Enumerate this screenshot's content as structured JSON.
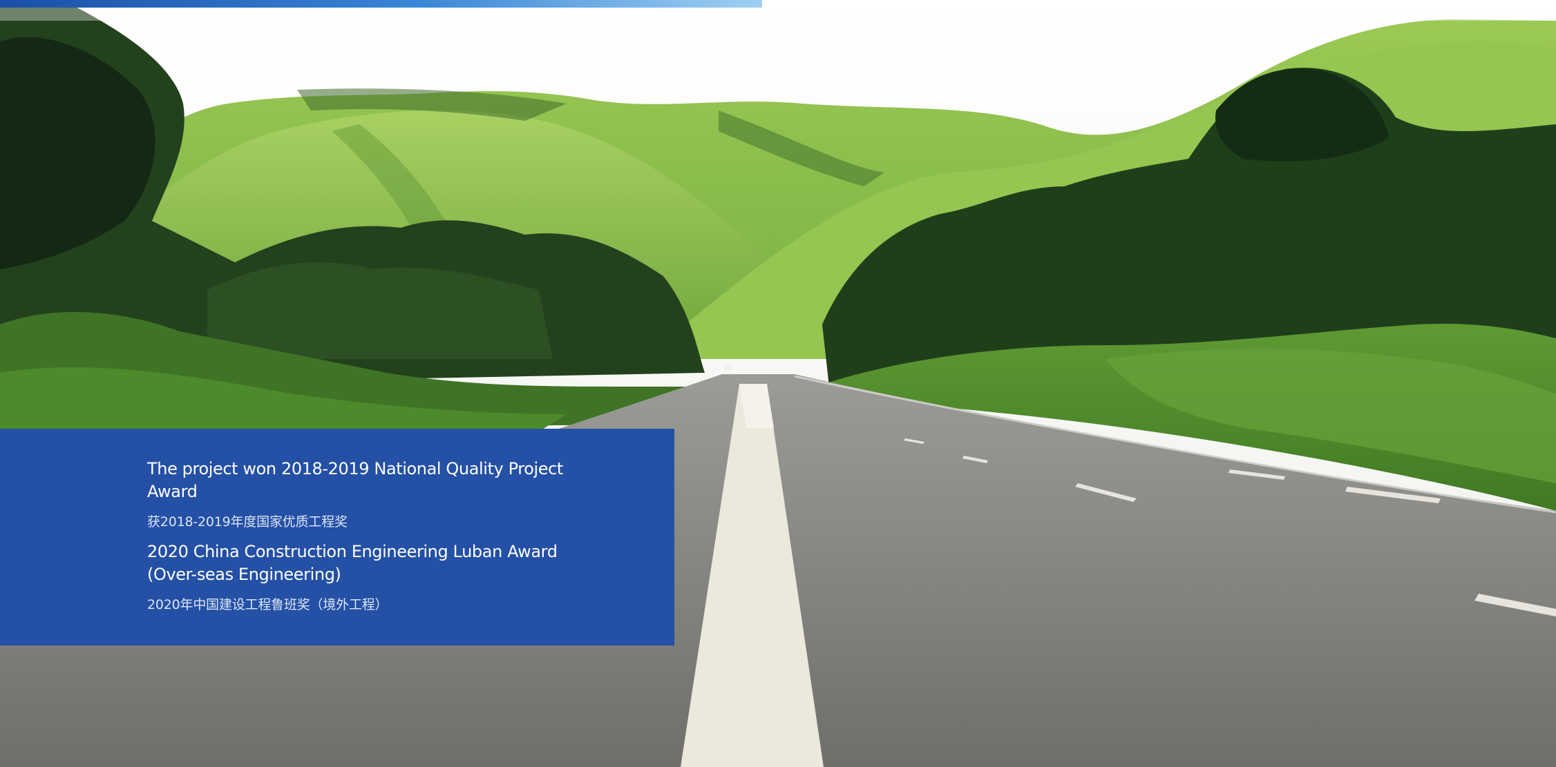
{
  "background": {
    "image": "road-through-green-hills-photo",
    "colors": {
      "sky": "#f4f5f2",
      "hills": "#8fc34a",
      "forest": "#1f3a1c",
      "road": "#7f7e7a",
      "center_line": "#ece9dc"
    }
  },
  "progress": {
    "fraction": 0.49,
    "colors": [
      "#1a4fa8",
      "#3b86d6",
      "#9fd0f3"
    ]
  },
  "panel": {
    "color": "#2450a5"
  },
  "awards": [
    {
      "title": "The project won 2018-2019 National Quality Project Award",
      "subtitle": "获2018-2019年度国家优质工程奖"
    },
    {
      "title": "2020 China Construction Engineering Luban Award (Over-seas Engineering)",
      "subtitle": "2020年中国建设工程鲁班奖（境外工程）"
    }
  ]
}
